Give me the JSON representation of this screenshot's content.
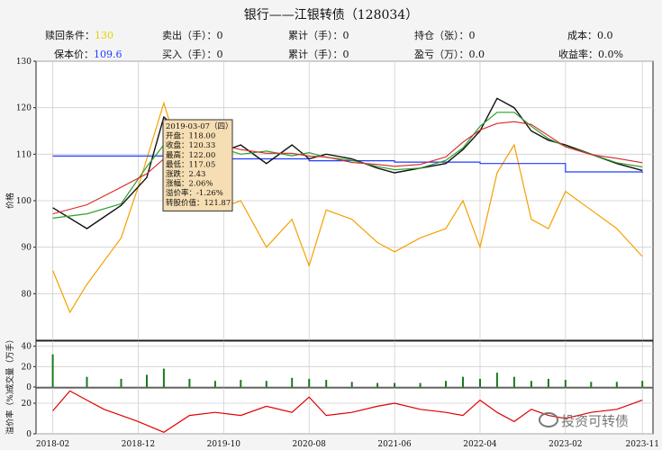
{
  "title": "银行——江银转债（128034）",
  "info": {
    "row1": [
      {
        "label": "赎回条件：",
        "value": "130",
        "color": "#e6d100"
      },
      {
        "label": "卖出（手）：",
        "value": "0"
      },
      {
        "label": "累计（手）：",
        "value": "0"
      },
      {
        "label": "持仓（张）：",
        "value": "0"
      },
      {
        "label": "成本：",
        "value": "0.0"
      }
    ],
    "row2": [
      {
        "label": "保本价：",
        "value": "109.6",
        "color": "#1f3cff"
      },
      {
        "label": "买入（手）：",
        "value": "0"
      },
      {
        "label": "累计（手）：",
        "value": "0"
      },
      {
        "label": "盈亏（万）：",
        "value": "0.0"
      },
      {
        "label": "收益率：",
        "value": "0.0%"
      }
    ]
  },
  "tooltip": [
    "2019-03-07（四）",
    "开盘：118.00",
    "收盘：120.33",
    "最高：122.00",
    "最低：117.05",
    "涨跌：2.43",
    "涨幅：2.06%",
    "溢价率：-1.26%",
    "转股价值：121.87"
  ],
  "watermark": "投资可转债",
  "colors": {
    "price": "#111111",
    "ma_green": "#2ca02c",
    "ma_red": "#d62728",
    "ma_yellow": "#e6c000",
    "conv_value": "#f5a000",
    "floor_line": "#1f3cff",
    "volume": "#1a7a1a",
    "premium": "#e00000",
    "tooltip_bg": "#f5deb3"
  },
  "chart_data": [
    {
      "type": "line",
      "panel": "price",
      "ylabel": "价格",
      "ylim": [
        70,
        130
      ],
      "yticks": [
        80,
        90,
        100,
        110,
        120,
        130
      ],
      "xticks": [
        "2018-02",
        "2018-12",
        "2019-10",
        "2020-08",
        "2021-06",
        "2022-04",
        "2023-02",
        "2023-11"
      ],
      "grid": true,
      "series": [
        {
          "name_hidden": "price",
          "x": [
            "2018-02",
            "2018-06",
            "2018-10",
            "2019-01",
            "2019-03",
            "2019-06",
            "2019-09",
            "2019-12",
            "2020-03",
            "2020-06",
            "2020-08",
            "2020-10",
            "2021-01",
            "2021-04",
            "2021-06",
            "2021-09",
            "2021-12",
            "2022-02",
            "2022-04",
            "2022-06",
            "2022-08",
            "2022-10",
            "2022-12",
            "2023-02",
            "2023-05",
            "2023-08",
            "2023-11"
          ],
          "values": [
            98.5,
            94,
            99,
            105,
            118,
            113,
            110,
            112,
            108,
            112,
            109,
            110,
            109,
            107,
            106,
            107,
            108,
            111,
            115,
            122,
            120,
            115,
            113,
            112,
            110,
            108,
            106.5
          ]
        },
        {
          "name_hidden": "conv_value",
          "x": [
            "2018-02",
            "2018-04",
            "2018-06",
            "2018-08",
            "2018-10",
            "2018-12",
            "2019-03",
            "2019-06",
            "2019-09",
            "2019-12",
            "2020-03",
            "2020-06",
            "2020-08",
            "2020-10",
            "2021-01",
            "2021-04",
            "2021-06",
            "2021-09",
            "2021-12",
            "2022-02",
            "2022-04",
            "2022-06",
            "2022-08",
            "2022-10",
            "2022-12",
            "2023-02",
            "2023-05",
            "2023-08",
            "2023-11"
          ],
          "values": [
            85,
            76,
            82,
            87,
            92,
            103,
            121,
            103,
            98,
            100,
            90,
            96,
            86,
            98,
            96,
            91,
            89,
            92,
            94,
            100,
            90,
            106,
            112,
            96,
            94,
            102,
            98,
            94,
            88
          ]
        },
        {
          "name_hidden": "floor_line",
          "x": [
            "2018-02",
            "2018-12",
            "2019-03",
            "2019-10",
            "2020-08",
            "2021-06",
            "2022-04",
            "2023-02",
            "2023-11"
          ],
          "values": [
            109.6,
            109.6,
            109.3,
            109.0,
            108.6,
            108.3,
            108.0,
            106.2,
            106.0
          ]
        }
      ]
    },
    {
      "type": "bar",
      "panel": "volume",
      "ylabel": "成交量（万手）",
      "ylim": [
        0,
        45
      ],
      "yticks": [
        0,
        20,
        40
      ],
      "x": [
        "2018-02",
        "2018-06",
        "2018-10",
        "2019-01",
        "2019-03",
        "2019-06",
        "2019-09",
        "2019-12",
        "2020-03",
        "2020-06",
        "2020-08",
        "2020-10",
        "2021-01",
        "2021-04",
        "2021-06",
        "2021-09",
        "2021-12",
        "2022-02",
        "2022-04",
        "2022-06",
        "2022-08",
        "2022-10",
        "2022-12",
        "2023-02",
        "2023-05",
        "2023-08",
        "2023-11"
      ],
      "values": [
        32,
        10,
        8,
        12,
        18,
        8,
        6,
        7,
        6,
        9,
        8,
        7,
        5,
        4,
        4,
        4,
        6,
        10,
        8,
        14,
        10,
        6,
        8,
        7,
        5,
        5,
        6
      ]
    },
    {
      "type": "line",
      "panel": "premium",
      "ylabel": "溢价率（%）",
      "ylim": [
        0,
        30
      ],
      "yticks": [
        0,
        20
      ],
      "x": [
        "2018-02",
        "2018-04",
        "2018-06",
        "2018-08",
        "2018-10",
        "2018-12",
        "2019-03",
        "2019-06",
        "2019-09",
        "2019-12",
        "2020-03",
        "2020-06",
        "2020-08",
        "2020-10",
        "2021-01",
        "2021-04",
        "2021-06",
        "2021-09",
        "2021-12",
        "2022-02",
        "2022-04",
        "2022-06",
        "2022-08",
        "2022-10",
        "2022-12",
        "2023-02",
        "2023-05",
        "2023-08",
        "2023-11"
      ],
      "values": [
        15,
        28,
        22,
        16,
        12,
        8,
        1,
        12,
        14,
        12,
        18,
        14,
        24,
        12,
        14,
        18,
        20,
        16,
        14,
        12,
        22,
        14,
        8,
        16,
        12,
        10,
        14,
        16,
        22
      ]
    }
  ]
}
